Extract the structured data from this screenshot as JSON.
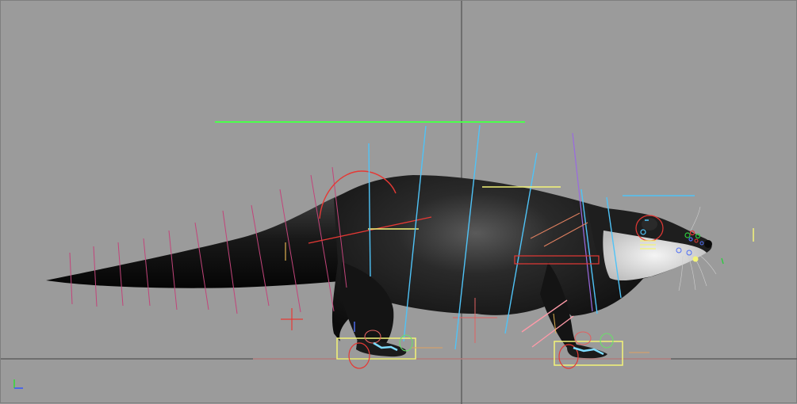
{
  "viewport": {
    "background": "#9b9b9b",
    "grid_line_color": "#5f5f5f",
    "view": "side-orthographic"
  },
  "model": {
    "subject": "otter",
    "body_color": "#1c1c1c",
    "belly_color": "#e8e8e8"
  },
  "rig": {
    "tail_controls_color": "#c2447a",
    "spine_controls_color": "#4fc3f7",
    "hip_control_color": "#e53935",
    "ground_line_color": "#7dff5a",
    "foot_box_color": "#f4f478",
    "head_controls_color": "#4fc3f7"
  },
  "axis_gizmo": {
    "x_color": "#3355ff",
    "y_color": "#33dd33"
  }
}
